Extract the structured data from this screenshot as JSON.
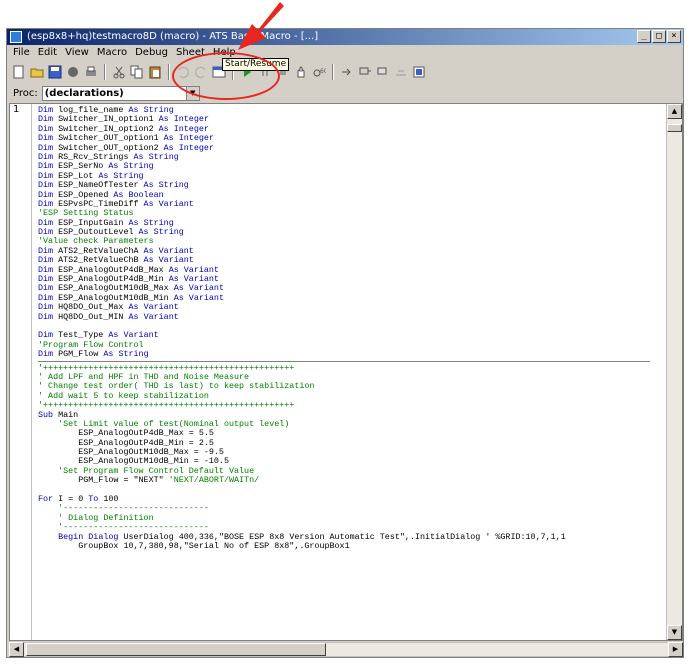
{
  "window": {
    "title": "(esp8x8+hq)testmacro8D (macro) - ATS Basic Macro - [...]",
    "controls": [
      "_",
      "□",
      "×"
    ]
  },
  "menu": [
    "File",
    "Edit",
    "View",
    "Macro",
    "Debug",
    "Sheet",
    "Help"
  ],
  "toolbar": {
    "icons": [
      "new-icon",
      "open-icon",
      "save-icon",
      "tools-icon",
      "print-icon",
      "cut-icon",
      "copy-icon",
      "paste-icon",
      "undo-icon",
      "redo-icon",
      "dialog-icon",
      "run-icon",
      "pause-icon",
      "stop-icon",
      "hand-icon",
      "watch-icon",
      "step-into-icon",
      "step-over-icon",
      "step-out-icon",
      "breakpoint-icon"
    ],
    "tooltip": "Start/Resume"
  },
  "proc": {
    "label": "Proc:",
    "value": "(declarations)"
  },
  "gutter": "1",
  "code": {
    "section1": [
      "Dim log_file_name As String",
      "Dim Switcher_IN_option1 As Integer",
      "Dim Switcher_IN_option2 As Integer",
      "Dim Switcher_OUT_option1 As Integer",
      "Dim Switcher_OUT_option2 As Integer",
      "Dim RS_Rcv_Strings As String",
      "Dim ESP_SerNo As String",
      "Dim ESP_Lot As String",
      "Dim ESP_NameOfTester As String",
      "Dim ESP_Opened As Boolean",
      "Dim ESPvsPC_TimeDiff As Variant",
      "'ESP Setting Status",
      "Dim ESP_InputGain As String",
      "Dim ESP_OutoutLevel As String",
      "'Value check Parameters",
      "Dim ATS2_RetValueChA As Variant",
      "Dim ATS2_RetValueChB As Variant",
      "Dim ESP_AnalogOutP4dB_Max As Variant",
      "Dim ESP_AnalogOutP4dB_Min As Variant",
      "Dim ESP_AnalogOutM10dB_Max As Variant",
      "Dim ESP_AnalogOutM10dB_Min As Variant",
      "Dim HQ8DO_Out_Max As Variant",
      "Dim HQ8DO_Out_MIN As Variant",
      "",
      "Dim Test_Type As Variant",
      "'Program Flow Control",
      "Dim PGM_Flow As String"
    ],
    "section2": [
      "'++++++++++++++++++++++++++++++++++++++++++++++++++",
      "' Add LPF and HPF in THD and Noise Measure",
      "' Change test order( THD is last) to keep stabilization",
      "' Add wait 5 to keep stabilization",
      "'++++++++++++++++++++++++++++++++++++++++++++++++++",
      "Sub Main",
      "    'Set Limit value of test(Nominal output level)",
      "        ESP_AnalogOutP4dB_Max = 5.5",
      "        ESP_AnalogOutP4dB_Min = 2.5",
      "        ESP_AnalogOutM10dB_Max = -9.5",
      "        ESP_AnalogOutM10dB_Min = -10.5",
      "    'Set Program Flow Control Default Value",
      "        PGM_Flow = \"NEXT\" 'NEXT/ABORT/WAITn/",
      "",
      "For I = 0 To 100",
      "    '-----------------------------",
      "    ' Dialog Definition",
      "    '-----------------------------",
      "    Begin Dialog UserDialog 400,336,\"BOSE ESP 8x8 Version Automatic Test\",.InitialDialog ' %GRID:10,7,1,1",
      "        GroupBox 10,7,380,98,\"Serial No of ESP 8x8\",.GroupBox1"
    ]
  },
  "colors": {
    "keyword": "#0000c0",
    "comment": "#008000",
    "annotation": "#e8261f"
  }
}
